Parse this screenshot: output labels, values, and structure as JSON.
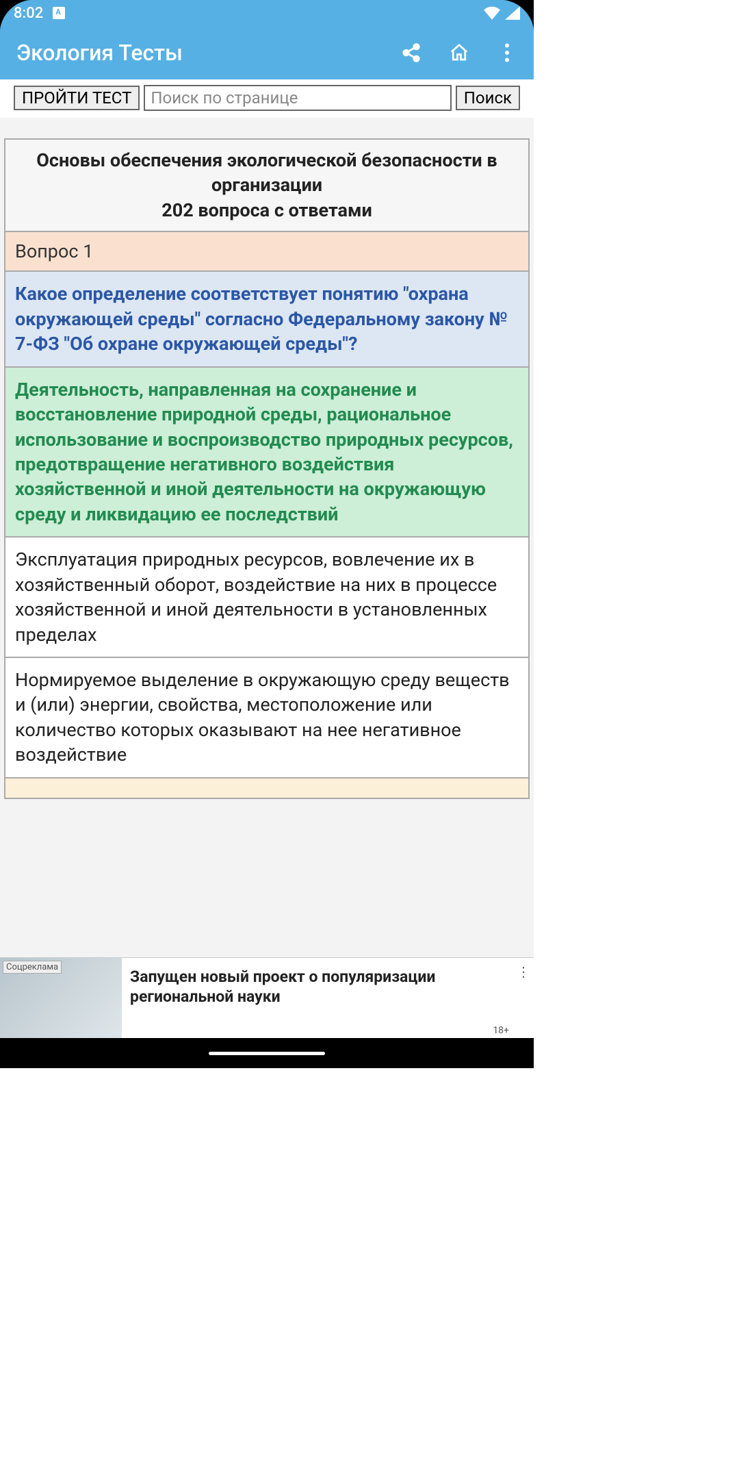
{
  "status": {
    "time": "8:02"
  },
  "appbar": {
    "title": "Экология Тесты"
  },
  "toolbar": {
    "take_test": "ПРОЙТИ ТЕСТ",
    "search_placeholder": "Поиск по странице",
    "search_btn": "Поиск"
  },
  "quiz": {
    "heading_line1": "Основы обеспечения экологической безопасности в организации",
    "heading_line2": "202 вопроса с ответами",
    "q_number": "Вопрос 1",
    "question": "Какое определение соответствует понятию \"охрана окружающей среды\" согласно Федеральному закону № 7-ФЗ \"Об охране окружающей среды\"?",
    "answers": [
      "Деятельность, направленная на сохранение и восстановление природной среды, рациональное использование и воспроизводство природных ресурсов, предотвращение негативного воздействия хозяйственной и иной деятельности на окружающую среду и ликвидацию ее последствий",
      "Эксплуатация природных ресурсов, вовлечение их в хозяйственный оборот, воздействие на них в процессе хозяйственной и иной деятельности в установленных пределах",
      "Нормируемое выделение в окружающую среду веществ и (или) энергии, свойства, местоположение или количество которых оказывают на нее негативное воздействие"
    ]
  },
  "ad": {
    "tag": "Соцреклама",
    "text": "Запущен новый проект о популяри­зации региональной науки",
    "age": "18+"
  }
}
